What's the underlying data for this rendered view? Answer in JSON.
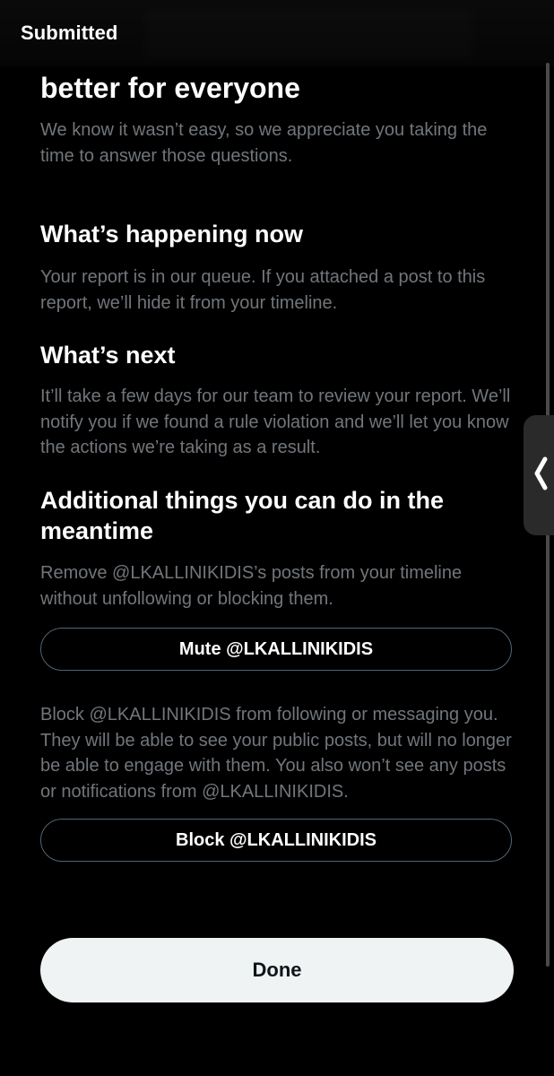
{
  "header": {
    "title": "Submitted"
  },
  "intro": {
    "heading": "better for everyone",
    "body": "We know it wasn’t easy, so we appreciate you taking the time to answer those questions."
  },
  "sections": [
    {
      "heading": "What’s happening now",
      "body": "Your report is in our queue. If you attached a post to this report, we’ll hide it from your timeline."
    },
    {
      "heading": "What’s next",
      "body": "It’ll take a few days for our team to review your report. We’ll notify you if we found a rule violation and we’ll let you know the actions we’re taking as a result."
    },
    {
      "heading": "Additional things you can do in the meantime",
      "mute_description": "Remove @LKALLINIKIDIS’s posts from your timeline without unfollowing or blocking them.",
      "mute_button": "Mute @LKALLINIKIDIS",
      "block_description": "Block @LKALLINIKIDIS from following or messaging you. They will be able to see your public posts, but will no longer be able to engage with them. You also won’t see any posts or notifications from @LKALLINIKIDIS.",
      "block_button": "Block @LKALLINIKIDIS"
    }
  ],
  "footer": {
    "done_label": "Done"
  },
  "icons": {
    "side_handle": "chevron-left-icon"
  },
  "colors": {
    "background": "#000000",
    "primary_text": "#ffffff",
    "secondary_text": "#71767b",
    "button_border": "#536471",
    "done_button_bg": "#eff3f4"
  }
}
